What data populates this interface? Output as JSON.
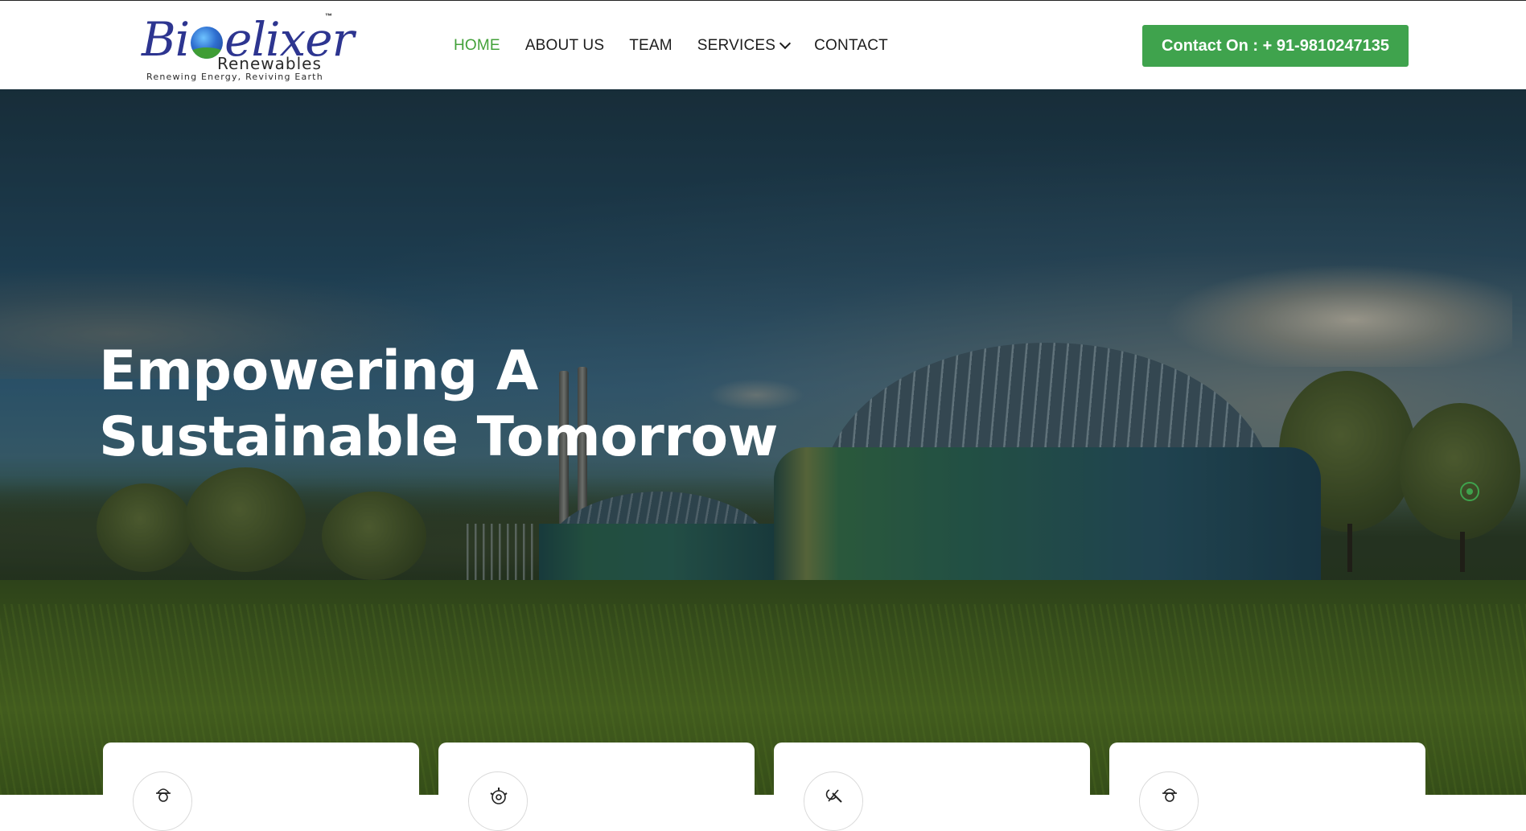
{
  "brand": {
    "name": "Bioelixer",
    "trademark": "™",
    "subtitle": "Renewables",
    "tagline": "Renewing Energy, Reviving Earth",
    "primary_color": "#3fa34d",
    "logo_color": "#2d3590"
  },
  "nav": {
    "items": [
      {
        "label": "HOME",
        "active": true
      },
      {
        "label": "ABOUT US",
        "active": false
      },
      {
        "label": "TEAM",
        "active": false
      },
      {
        "label": "SERVICES",
        "active": false,
        "icon": "chevron-down-icon"
      },
      {
        "label": "CONTACT",
        "active": false
      }
    ],
    "active_color": "#43a13a",
    "text_color": "#1c1c1c"
  },
  "contact_button": {
    "label": "Contact On : + 91-9810247135"
  },
  "hero": {
    "title_line1": "Empowering A",
    "title_line2": "Sustainable Tomorrow",
    "slider_indicator_icon": "slider-dot-icon"
  },
  "cards": [
    {
      "icon": "worker-icon"
    },
    {
      "icon": "gear-icon"
    },
    {
      "icon": "tools-icon"
    },
    {
      "icon": "worker-icon"
    }
  ]
}
